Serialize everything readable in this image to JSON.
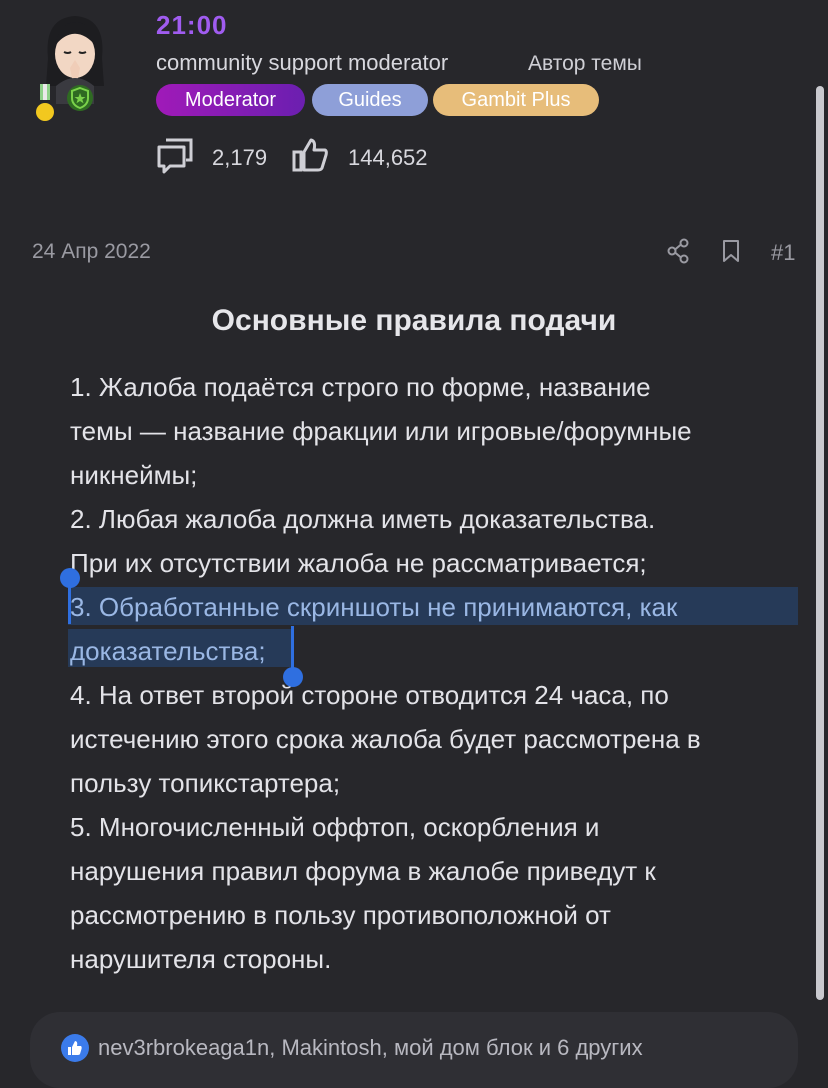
{
  "user": {
    "name": "21:00",
    "role": "community support moderator",
    "author_label": "Автор темы",
    "badges": [
      "Moderator",
      "Guides",
      "Gambit Plus"
    ],
    "messages_count": "2,179",
    "likes_count": "144,652"
  },
  "post": {
    "date": "24 Апр 2022",
    "number": "#1",
    "title": "Основные правила подачи",
    "lines": [
      "1. Жалоба подаётся строго по форме, название",
      "темы — название фракции или игровые/форумные",
      "никнеймы;",
      "2. Любая жалоба должна иметь доказательства.",
      "При их отсутствии жалоба не рассматривается;",
      "3. Обработанные скриншоты не принимаются, как",
      "доказательства;",
      "4. На ответ второй стороне отводится 24 часа, по",
      "истечению этого срока жалоба будет рассмотрена в",
      "пользу топикстартера;",
      "5. Многочисленный оффтоп, оскорбления и",
      "нарушения правил форума в жалобе приведут к",
      "рассмотрению в пользу противоположной от",
      "нарушителя стороны."
    ]
  },
  "reactions": {
    "text": "nev3rbrokeaga1n, Makintosh, мой дом блок и 6 других"
  },
  "colors": {
    "background": "#27272b",
    "username": "#a05cf0",
    "selection": "#263a58",
    "handle": "#2f6fe0",
    "like": "#3b7bea"
  },
  "icons": [
    "medal-icon",
    "shield-badge-icon",
    "messages-icon",
    "thumbs-up-icon",
    "share-icon",
    "bookmark-icon",
    "like-reaction-icon"
  ]
}
